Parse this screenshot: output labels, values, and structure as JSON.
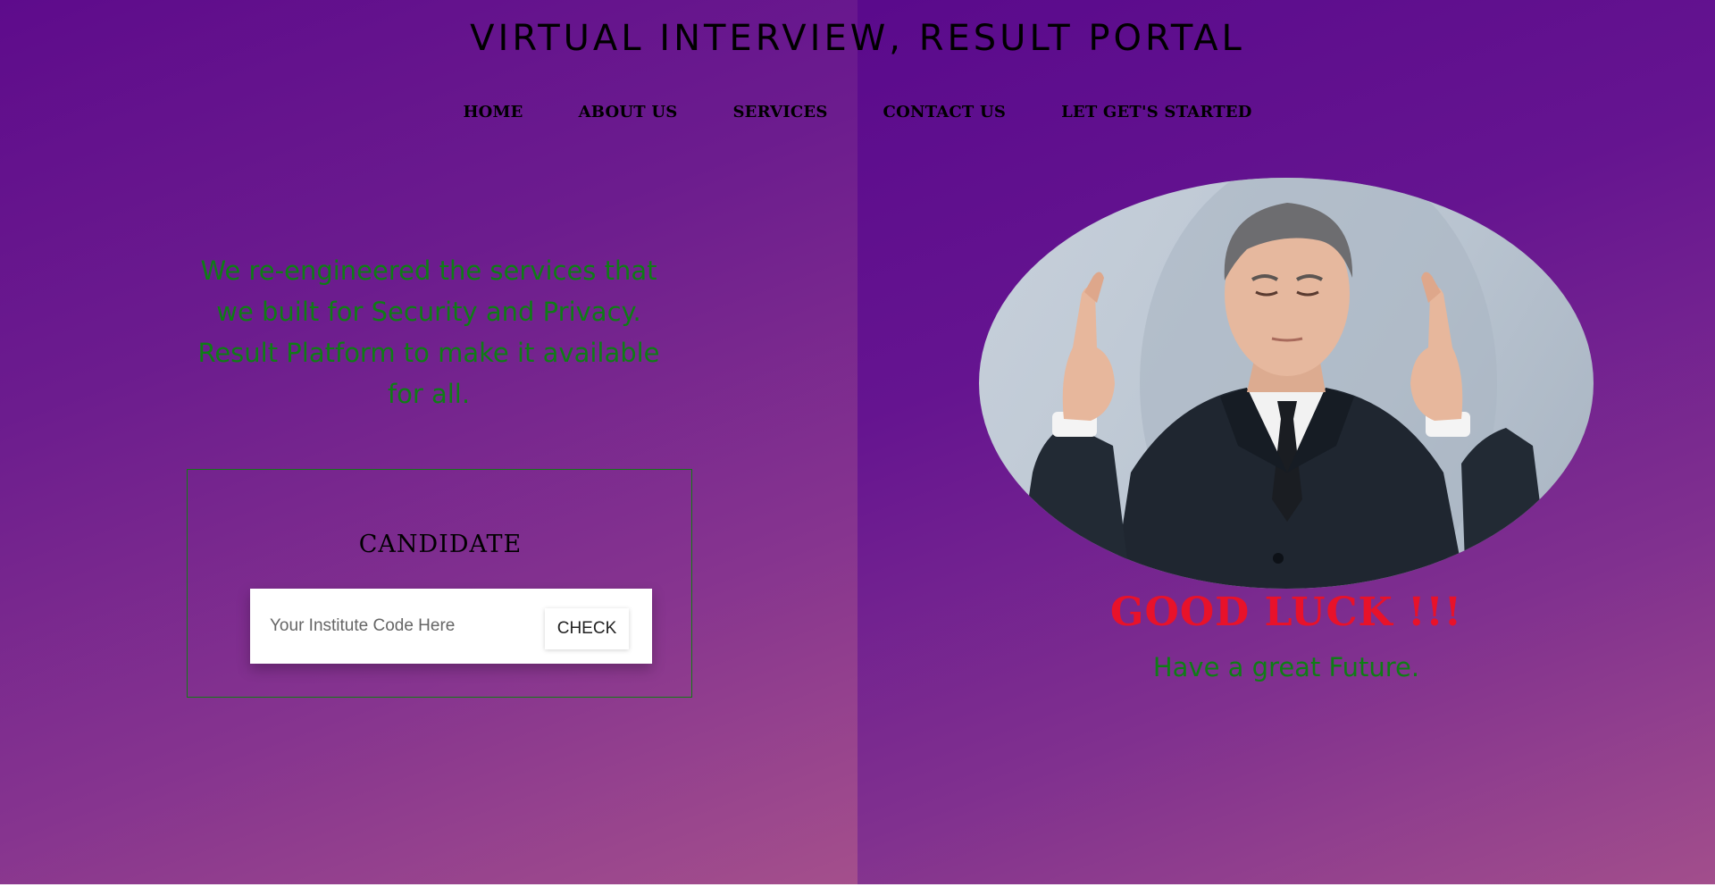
{
  "header": {
    "title": "VIRTUAL INTERVIEW, RESULT PORTAL"
  },
  "nav": {
    "items": [
      {
        "label": "HOME"
      },
      {
        "label": "ABOUT US"
      },
      {
        "label": "SERVICES"
      },
      {
        "label": "CONTACT US"
      },
      {
        "label": "LET GET'S STARTED"
      }
    ]
  },
  "hero": {
    "tagline": "We re-engineered the services that we built for Security and Privacy. Result Platform to make it available for all."
  },
  "candidate": {
    "title": "CANDIDATE",
    "input_placeholder": "Your Institute Code Here",
    "input_value": "",
    "button_label": "CHECK"
  },
  "side": {
    "photo_subject": "man-in-suit-fingers-crossed",
    "good_luck": "GOOD LUCK !!!",
    "subtitle": "Have a great Future."
  },
  "colors": {
    "accent_green": "#0f7d16",
    "accent_red": "#e8122a",
    "background_purple": "#5e0b8c",
    "background_pink": "#a44f8c"
  }
}
